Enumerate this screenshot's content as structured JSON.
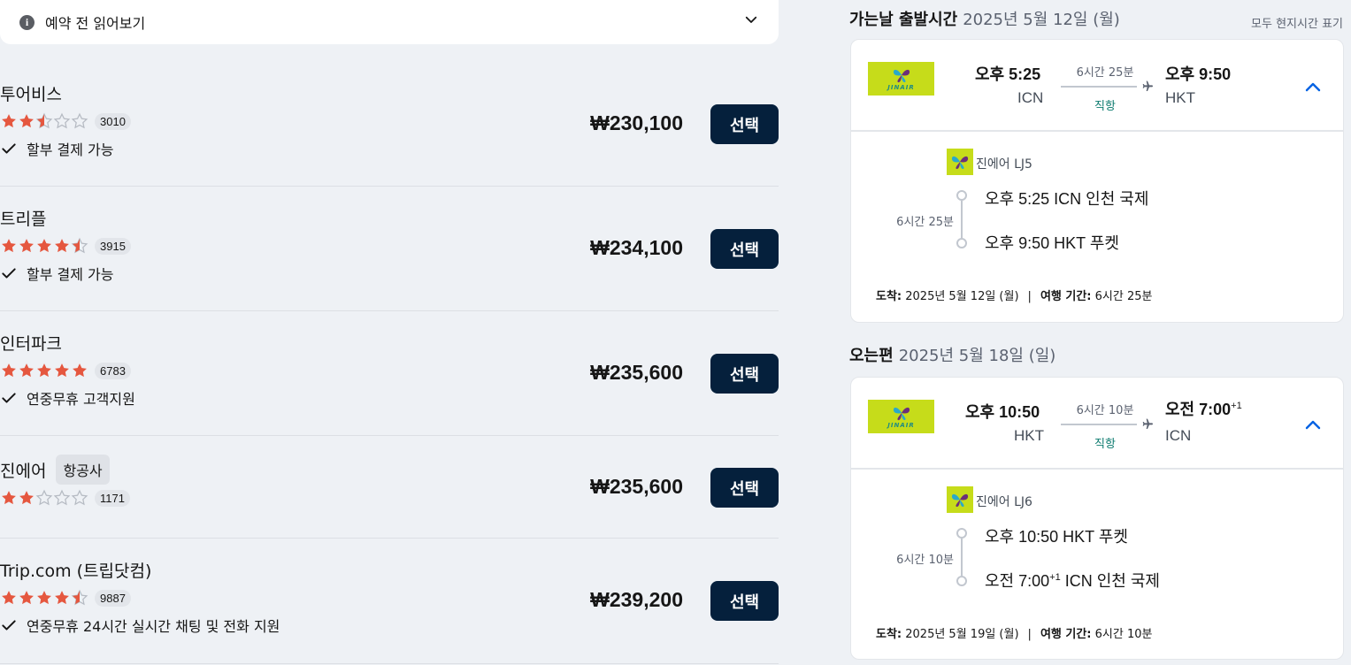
{
  "notice": {
    "label": "예약 전 읽어보기",
    "icon": "info-icon"
  },
  "providers": [
    {
      "name": "투어비스",
      "tag": "",
      "rating": 2.5,
      "rating_count": "3010",
      "feature": "할부 결제 가능",
      "price": "₩230,100",
      "button": "선택"
    },
    {
      "name": "트리플",
      "tag": "",
      "rating": 4.5,
      "rating_count": "3915",
      "feature": "할부 결제 가능",
      "price": "₩234,100",
      "button": "선택"
    },
    {
      "name": "인터파크",
      "tag": "",
      "rating": 5,
      "rating_count": "6783",
      "feature": "연중무휴 고객지원",
      "price": "₩235,600",
      "button": "선택"
    },
    {
      "name": "진에어",
      "tag": "항공사",
      "rating": 2,
      "rating_count": "1171",
      "feature": "",
      "price": "₩235,600",
      "button": "선택"
    },
    {
      "name": "Trip.com (트립닷컴)",
      "tag": "",
      "rating": 4.5,
      "rating_count": "9887",
      "feature": "연중무휴 24시간 실시간 채팅 및 전화 지원",
      "price": "₩239,200",
      "button": "선택"
    }
  ],
  "colors": {
    "star": "#e5573f",
    "star_empty": "#b6bbc3",
    "button_bg": "#05203c",
    "logo_bg": "#c6dc1a",
    "direct": "#0b7a6e",
    "chevron_up": "#0062e3"
  },
  "local_time_note": "모두 현지시간 표기",
  "outbound": {
    "heading": "가는날 출발시간",
    "date": "2025년 5월 12일 (월)",
    "logo_text": "JINAIR",
    "depart_time": "오후 5:25",
    "depart_code": "ICN",
    "duration": "6시간 25분",
    "direct": "직항",
    "arrive_time": "오후 9:50",
    "arrive_sup": "",
    "arrive_code": "HKT",
    "airline_flight": "진에어 LJ5",
    "leg_duration": "6시간 25분",
    "stop1": "오후 5:25 ICN 인천 국제",
    "stop2_time": "오후 9:50",
    "stop2_sup": "",
    "stop2_rest": " HKT 푸켓",
    "arrival_label": "도착:",
    "arrival_value": " 2025년 5월 12일 (월)",
    "separator": "|",
    "trip_label": "여행 기간:",
    "trip_value": " 6시간 25분"
  },
  "inbound": {
    "heading": "오는편",
    "date": "2025년 5월 18일 (일)",
    "logo_text": "JINAIR",
    "depart_time": "오후 10:50",
    "depart_code": "HKT",
    "duration": "6시간 10분",
    "direct": "직항",
    "arrive_time": "오전 7:00",
    "arrive_sup": "+1",
    "arrive_code": "ICN",
    "airline_flight": "진에어 LJ6",
    "leg_duration": "6시간 10분",
    "stop1": "오후 10:50 HKT 푸켓",
    "stop2_time": "오전 7:00",
    "stop2_sup": "+1",
    "stop2_rest": " ICN 인천 국제",
    "arrival_label": "도착:",
    "arrival_value": " 2025년 5월 19일 (월)",
    "separator": "|",
    "trip_label": "여행 기간:",
    "trip_value": " 6시간 10분"
  }
}
